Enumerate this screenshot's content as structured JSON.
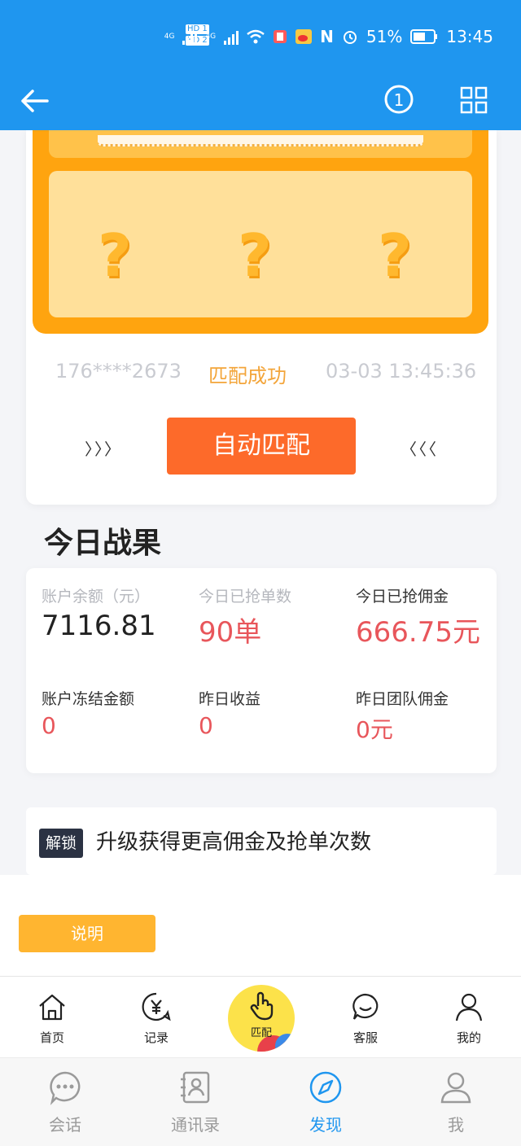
{
  "status_bar": {
    "sim1": "HD 1",
    "sim2": "HD 2",
    "net1": "4G",
    "net2": "4G",
    "nfc": "N",
    "battery": "51%",
    "time": "13:45"
  },
  "navbar": {
    "info_count": "1"
  },
  "slot": {
    "q1": "?",
    "q2": "?",
    "q3": "?"
  },
  "match": {
    "phone": "176****2673",
    "status": "匹配成功",
    "time": "03-03 13:45:36"
  },
  "auto_match": {
    "left_arrows": "〉〉〉",
    "label": "自动匹配",
    "right_arrows": "〈〈〈"
  },
  "today": {
    "title": "今日战果",
    "stats": [
      {
        "label": "账户余额（元）",
        "value": "7116.81"
      },
      {
        "label": "今日已抢单数",
        "value": "90单"
      },
      {
        "label": "今日已抢佣金",
        "value": "666.75元"
      },
      {
        "label": "账户冻结金额",
        "value": "0"
      },
      {
        "label": "昨日收益",
        "value": "0"
      },
      {
        "label": "昨日团队佣金",
        "value": "0元"
      }
    ]
  },
  "unlock": {
    "tag": "解锁",
    "text": "升级获得更高佣金及抢单次数"
  },
  "explain_button": "说明",
  "tabbar": {
    "home": "首页",
    "records": "记录",
    "match": "匹配",
    "service": "客服",
    "mine": "我的"
  },
  "system_nav": {
    "chat": "会话",
    "contacts": "通讯录",
    "discover": "发现",
    "me": "我"
  },
  "colors": {
    "primary": "#1f96ef",
    "accent_orange": "#fd6a2a",
    "red_value": "#e8565b",
    "slot_orange": "#ffa40f"
  }
}
